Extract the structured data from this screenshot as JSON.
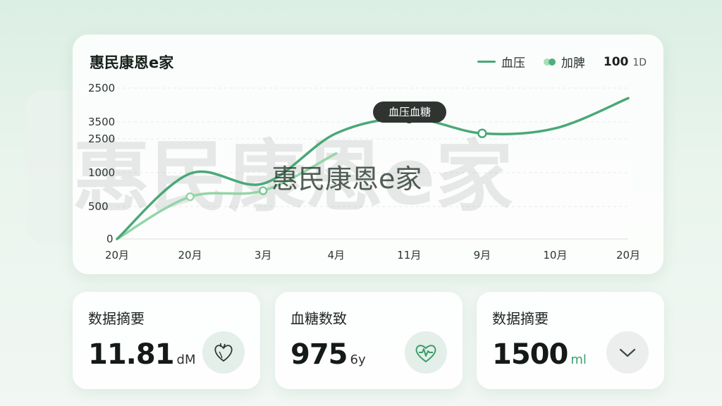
{
  "chart_card": {
    "title": "惠民康恩e家",
    "legend": {
      "line_label": "血压",
      "dots_label": "加脾",
      "range_value": "100",
      "range_suffix": "1D"
    },
    "tooltip": "血压血糖",
    "watermark": "惠民康恩e家",
    "colors": {
      "series_dark": "#4aa878",
      "series_light": "#94d5a8",
      "legend_dot_light": "#a6dfb7",
      "legend_dot_dark": "#4cb07e"
    }
  },
  "chart_data": {
    "type": "line",
    "categories": [
      "20月",
      "20月",
      "3月",
      "4月",
      "11月",
      "9月",
      "10月",
      "20月"
    ],
    "y_tick_labels": [
      "2500",
      "3500",
      "2500",
      "1000",
      "500",
      "0"
    ],
    "series": [
      {
        "name": "血压",
        "values": [
          0,
          650,
          550,
          1050,
          1200,
          1050,
          1100,
          1400
        ],
        "color": "#4aa878"
      },
      {
        "name": "加脾",
        "values": [
          0,
          420,
          480,
          850
        ],
        "color": "#94d5a8"
      }
    ],
    "grid": true
  },
  "stats": [
    {
      "title": "数据摘要",
      "value": "11.81",
      "unit": "dM",
      "icon": "heart-icon"
    },
    {
      "title": "血糖数致",
      "value": "975",
      "unit": "6y",
      "icon": "heartbeat-icon"
    },
    {
      "title": "数据摘要",
      "value": "1500",
      "unit": "ml",
      "icon": "chevron-down-icon"
    }
  ]
}
